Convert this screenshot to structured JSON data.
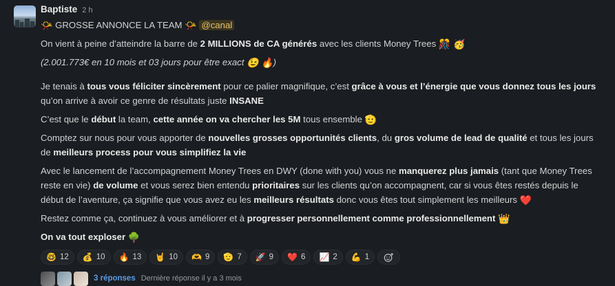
{
  "author": {
    "name": "Baptiste",
    "time": "2 h"
  },
  "announce": {
    "emoji_left": "📯",
    "text": "GROSSE ANNONCE LA TEAM",
    "emoji_right": "📯",
    "mention": "@canal"
  },
  "p1": {
    "a": "On vient à peine d’atteindre la barre de ",
    "b": "2 MILLIONS de CA générés",
    "c": " avec les clients Money Trees ",
    "e1": "🎊",
    "e2": "🥳"
  },
  "p2": {
    "a": "(2.001.773€ en 10 mois et 03 jours pour être exact ",
    "e1": "😉",
    "e2": "🔥",
    "b": ")"
  },
  "p3": {
    "a": "Je tenais à ",
    "b": "tous vous féliciter sincèrement",
    "c": " pour ce palier magnifique, c’est ",
    "d": "grâce à vous et l’énergie que vous donnez tous les jours",
    "e": " qu’on arrive à avoir ce genre de résultats juste ",
    "f": "INSANE"
  },
  "p4": {
    "a": "C’est que le ",
    "b": "début",
    "c": " la team, ",
    "d": "cette année on va chercher les 5M",
    "e": " tous ensemble ",
    "emoji": "🫡"
  },
  "p5": {
    "a": "Comptez sur nous pour vous apporter de ",
    "b": "nouvelles grosses opportunités clients",
    "c": ", du ",
    "d": "gros volume de lead de qualité",
    "e": " et tous les jours de ",
    "f": "meilleurs process pour vous simplifiez la vie"
  },
  "p6": {
    "a": "Avec le lancement de l’accompagnement Money Trees en DWY (done with you) vous ne ",
    "b": "manquerez plus jamais",
    "c": " (tant que Money Trees reste en vie) ",
    "d": "de volume",
    "e": " et vous serez bien entendu ",
    "f": "prioritaires",
    "g": " sur les clients qu’on accompagnent, car si vous êtes restés depuis le début de l’aventure, ça signifie que vous avez eu les ",
    "h": "meilleurs résultats",
    "i": " donc vous êtes tout simplement les meilleurs ",
    "emoji": "❤️"
  },
  "p7": {
    "a": "Restez comme ça, continuez à vous améliorer et à ",
    "b": "progresser personnellement comme professionnellement",
    "emoji": "👑"
  },
  "p8": {
    "a": "On va tout exploser",
    "emoji": "🌳"
  },
  "reactions": [
    {
      "emoji": "🤓",
      "count": "12"
    },
    {
      "emoji": "💰",
      "count": "10"
    },
    {
      "emoji": "🔥",
      "count": "13"
    },
    {
      "emoji": "🤘",
      "count": "10"
    },
    {
      "emoji": "🫶",
      "count": "9"
    },
    {
      "emoji": "🫡",
      "count": "7"
    },
    {
      "emoji": "🚀",
      "count": "9"
    },
    {
      "emoji": "❤️",
      "count": "6"
    },
    {
      "emoji": "📈",
      "count": "2"
    },
    {
      "emoji": "💪",
      "count": "1"
    }
  ],
  "add_reaction_icon": "add-reaction-icon",
  "thread": {
    "replies": "3 réponses",
    "last": "Dernière réponse il y a 3 mois"
  }
}
